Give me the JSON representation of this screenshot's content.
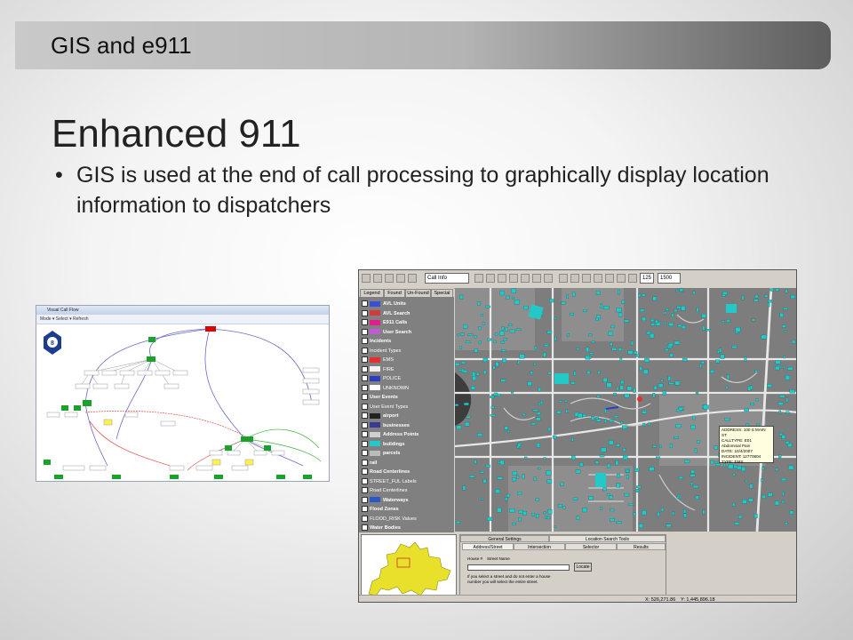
{
  "header": {
    "title": "GIS and e911"
  },
  "slide": {
    "title": "Enhanced 911",
    "bullet_marker": "•",
    "bullet": "GIS is used at the end of call processing to graphically display location information to dispatchers"
  },
  "call_flow_window": {
    "title": "Visual Call Flow",
    "toolbar": "Mode ▾   Select ▾   Refresh",
    "colors": {
      "node": "#1aa32a",
      "root": "#e00000",
      "highlight": "#fff24d"
    }
  },
  "gis_window": {
    "toolbar": {
      "layer_select": "Call Info",
      "zoom_select": "125",
      "scale_select": "1500"
    },
    "legend_tabs": [
      "Legend",
      "Found",
      "Un-Found",
      "Special"
    ],
    "legend_items": [
      {
        "label": "AVL Units",
        "bold": true,
        "symbol": "#3a4fd8"
      },
      {
        "label": "AVL Search",
        "bold": true,
        "symbol": "#d43a3a"
      },
      {
        "label": "E911 Calls",
        "bold": true,
        "symbol": "#e01e8a"
      },
      {
        "label": "User Search",
        "bold": true,
        "symbol": "#c25ad4"
      },
      {
        "label": "Incidents",
        "bold": true,
        "symbol": ""
      },
      {
        "label": "Incident Types",
        "bold": false,
        "symbol": ""
      },
      {
        "label": "EMS",
        "bold": false,
        "symbol": "#e53030"
      },
      {
        "label": "FIRE",
        "bold": false,
        "symbol": "#f2f2f2"
      },
      {
        "label": "POLICE",
        "bold": false,
        "symbol": "#2a3fc0"
      },
      {
        "label": "UNKNOWN",
        "bold": false,
        "symbol": "#ffffff"
      },
      {
        "label": "User Events",
        "bold": true,
        "symbol": ""
      },
      {
        "label": "User Event Types",
        "bold": false,
        "symbol": ""
      },
      {
        "label": "airport",
        "bold": true,
        "symbol": "#222222"
      },
      {
        "label": "businesses",
        "bold": true,
        "symbol": "#3a3a90"
      },
      {
        "label": "Address Points",
        "bold": true,
        "symbol": "#d0d0d0"
      },
      {
        "label": "buildings",
        "bold": true,
        "symbol": "#23c9c9"
      },
      {
        "label": "parcels",
        "bold": true,
        "symbol": "#bbbbbb"
      },
      {
        "label": "rail",
        "bold": true,
        "symbol": ""
      },
      {
        "label": "Road Centerlines",
        "bold": true,
        "symbol": ""
      },
      {
        "label": "STREET_FUL Labels",
        "bold": false,
        "symbol": ""
      },
      {
        "label": "Road Centerlines",
        "bold": false,
        "symbol": ""
      },
      {
        "label": "Waterways",
        "bold": true,
        "symbol": "#2b58c9"
      },
      {
        "label": "Flood Zones",
        "bold": true,
        "symbol": ""
      },
      {
        "label": "FLOOD_RISK Values",
        "bold": false,
        "symbol": ""
      },
      {
        "label": "Water Bodies",
        "bold": true,
        "symbol": ""
      }
    ],
    "tooltip": {
      "lines": [
        "ADDRESS: 100 S MAIN ST",
        "CALLTYPE: E01 Abdominal Pain",
        "DATE: 10/4/2007",
        "INCIDENT: 12770804",
        "TYPE: EMS"
      ]
    },
    "search_panel": {
      "tabs": [
        "General Settings",
        "Location Search Tools"
      ],
      "subtabs": [
        "Address/Street",
        "Intersection",
        "Selector",
        "Results"
      ],
      "house_label": "House #",
      "street_label": "Street Name",
      "locate_label": "Locate",
      "hint": "If you select a street and do not enter a house number you will select the entire street."
    },
    "status": {
      "x": "X: 526,271.86",
      "y": "Y: 1,445,896.18"
    },
    "colors": {
      "buildings": "#23c9c9",
      "tooltip_bg": "#ffffe0",
      "overview": "#e8e02a"
    }
  }
}
